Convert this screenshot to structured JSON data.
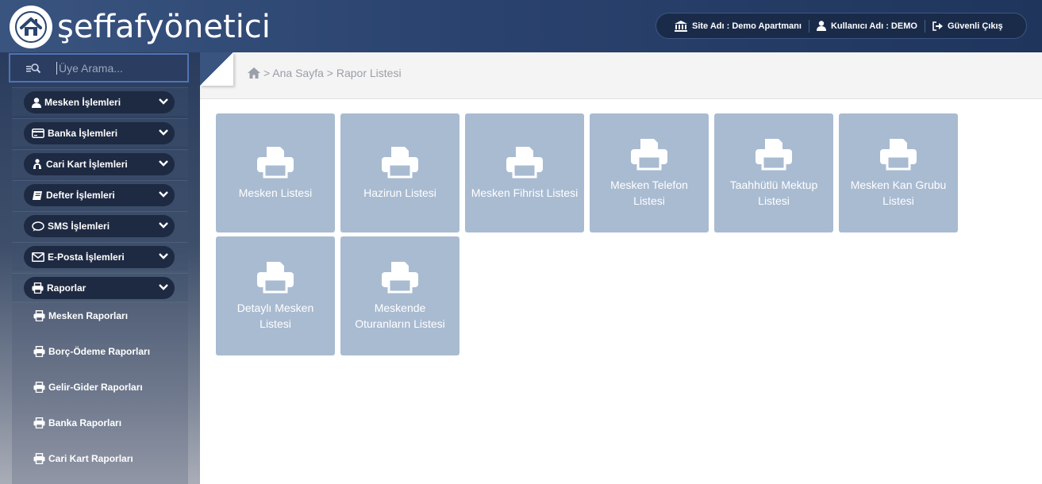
{
  "header": {
    "logo_text": "şeffafyönetici",
    "site_label": "Site Adı : Demo Apartmanı",
    "user_label": "Kullanıcı Adı : DEMO",
    "logout_label": "Güvenli Çıkış"
  },
  "sidebar": {
    "search_placeholder": "Üye Arama...",
    "menu": [
      {
        "label": "Mesken İşlemleri",
        "icon": "user-icon"
      },
      {
        "label": "Banka İşlemleri",
        "icon": "credit-card-icon"
      },
      {
        "label": "Cari Kart İşlemleri",
        "icon": "users-icon"
      },
      {
        "label": "Defter İşlemleri",
        "icon": "book-icon"
      },
      {
        "label": "SMS İşlemleri",
        "icon": "comment-icon"
      },
      {
        "label": "E-Posta İşlemleri",
        "icon": "envelope-icon"
      },
      {
        "label": "Raporlar",
        "icon": "print-icon"
      }
    ],
    "reports_sub": [
      "Mesken Raporları",
      "Borç-Ödeme Raporları",
      "Gelir-Gider Raporları",
      "Banka Raporları",
      "Cari Kart Raporları"
    ]
  },
  "breadcrumb": {
    "text": "> Ana Sayfa > Rapor Listesi"
  },
  "tiles": [
    {
      "line1": "Mesken Listesi",
      "line2": ""
    },
    {
      "line1": "Hazirun Listesi",
      "line2": ""
    },
    {
      "line1": "Mesken Fihrist Listesi",
      "line2": ""
    },
    {
      "line1": "Mesken Telefon",
      "line2": "Listesi"
    },
    {
      "line1": "Taahhütlü Mektup",
      "line2": "Listesi"
    },
    {
      "line1": "Mesken Kan Grubu",
      "line2": "Listesi"
    },
    {
      "line1": "Detaylı Mesken",
      "line2": "Listesi"
    },
    {
      "line1": "Meskende",
      "line2": "Oturanların Listesi"
    }
  ],
  "colors": {
    "header_bg": "#2b4470",
    "pill_bg": "#1e2a42",
    "tile_bg": "#a9bbd1",
    "search_border": "#4f74b6"
  }
}
